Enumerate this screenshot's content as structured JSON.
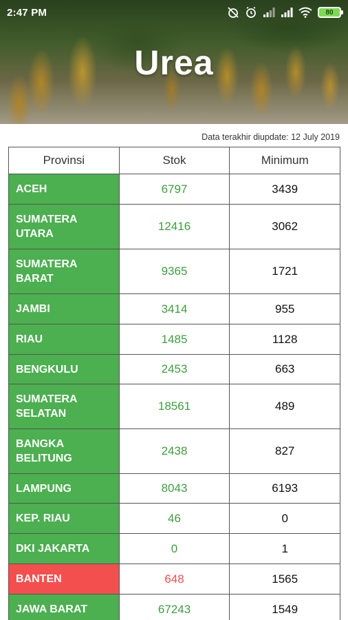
{
  "status": {
    "time": "2:47 PM",
    "battery": "80"
  },
  "title": "Urea",
  "last_update": "Data terakhir diupdate: 12 July 2019",
  "table": {
    "headers": [
      "Provinsi",
      "Stok",
      "Minimum"
    ],
    "rows": [
      {
        "province": "ACEH",
        "stock": "6797",
        "minimum": "3439",
        "status": "ok"
      },
      {
        "province": "SUMATERA UTARA",
        "stock": "12416",
        "minimum": "3062",
        "status": "ok"
      },
      {
        "province": "SUMATERA BARAT",
        "stock": "9365",
        "minimum": "1721",
        "status": "ok"
      },
      {
        "province": "JAMBI",
        "stock": "3414",
        "minimum": "955",
        "status": "ok"
      },
      {
        "province": "RIAU",
        "stock": "1485",
        "minimum": "1128",
        "status": "ok"
      },
      {
        "province": "BENGKULU",
        "stock": "2453",
        "minimum": "663",
        "status": "ok"
      },
      {
        "province": "SUMATERA SELATAN",
        "stock": "18561",
        "minimum": "489",
        "status": "ok"
      },
      {
        "province": "BANGKA BELITUNG",
        "stock": "2438",
        "minimum": "827",
        "status": "ok"
      },
      {
        "province": "LAMPUNG",
        "stock": "8043",
        "minimum": "6193",
        "status": "ok"
      },
      {
        "province": "KEP. RIAU",
        "stock": "46",
        "minimum": "0",
        "status": "ok"
      },
      {
        "province": "DKI JAKARTA",
        "stock": "0",
        "minimum": "1",
        "status": "ok"
      },
      {
        "province": "BANTEN",
        "stock": "648",
        "minimum": "1565",
        "status": "low"
      },
      {
        "province": "JAWA BARAT",
        "stock": "67243",
        "minimum": "1549",
        "status": "ok"
      }
    ]
  },
  "colors": {
    "ok": "#4caf50",
    "low": "#f44f4f",
    "stock_ok_text": "#3e9d3e"
  },
  "icons": [
    "alarm-off-icon",
    "alarm-clock-icon",
    "cell-signal-icon",
    "cell-signal-icon",
    "wifi-icon",
    "battery-icon"
  ]
}
